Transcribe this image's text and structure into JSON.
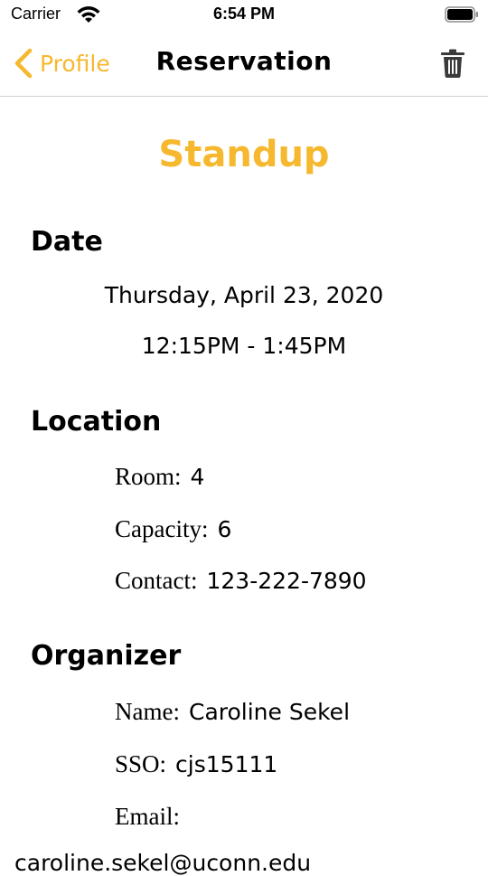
{
  "status_bar": {
    "carrier": "Carrier",
    "time": "6:54 PM",
    "icons": [
      "wifi-icon",
      "battery-icon"
    ]
  },
  "nav": {
    "back_label": "Profile",
    "title": "Reservation",
    "back_icon": "chevron-left-icon",
    "trash_icon": "trash-icon"
  },
  "colors": {
    "accent": "#f6b82e",
    "text": "#000000",
    "divider": "#cfcfcf"
  },
  "reservation": {
    "title": "Standup",
    "date_header": "Date",
    "date": "Thursday, April 23, 2020",
    "time_range": "12:15PM - 1:45PM",
    "location_header": "Location",
    "room_label": "Room:",
    "room_value": "4",
    "capacity_label": "Capacity:",
    "capacity_value": "6",
    "contact_label": "Contact:",
    "contact_value": "123-222-7890",
    "organizer_header": "Organizer",
    "name_label": "Name:",
    "name_value": "Caroline Sekel",
    "sso_label": "SSO:",
    "sso_value": "cjs15111",
    "email_label": "Email:",
    "email_value": "caroline.sekel@uconn.edu"
  }
}
